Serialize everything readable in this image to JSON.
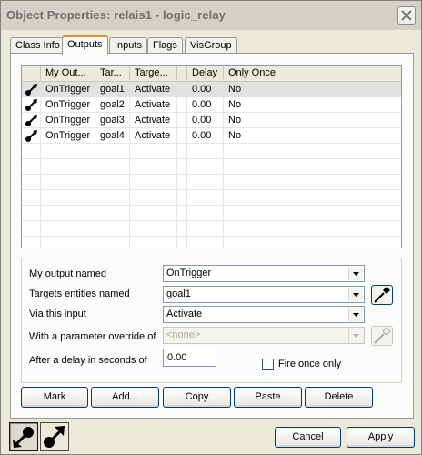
{
  "window": {
    "title": "Object Properties: relais1 - logic_relay",
    "close_glyph": "close-icon"
  },
  "tabs": [
    {
      "label": "Class Info",
      "active": false
    },
    {
      "label": "Outputs",
      "active": true
    },
    {
      "label": "Inputs",
      "active": false
    },
    {
      "label": "Flags",
      "active": false
    },
    {
      "label": "VisGroup",
      "active": false
    }
  ],
  "outputs_list": {
    "columns": [
      "",
      "My Out...",
      "Tar...",
      "Targe...",
      "",
      "Delay",
      "Only Once"
    ],
    "rows": [
      {
        "icon": "output-connection-icon",
        "output": "OnTrigger",
        "target": "goal1",
        "input": "Activate",
        "delay": "0.00",
        "only_once": "No",
        "selected": true
      },
      {
        "icon": "output-connection-icon",
        "output": "OnTrigger",
        "target": "goal2",
        "input": "Activate",
        "delay": "0.00",
        "only_once": "No",
        "selected": false
      },
      {
        "icon": "output-connection-icon",
        "output": "OnTrigger",
        "target": "goal3",
        "input": "Activate",
        "delay": "0.00",
        "only_once": "No",
        "selected": false
      },
      {
        "icon": "output-connection-icon",
        "output": "OnTrigger",
        "target": "goal4",
        "input": "Activate",
        "delay": "0.00",
        "only_once": "No",
        "selected": false
      }
    ]
  },
  "details": {
    "output_label": "My output named",
    "output_value": "OnTrigger",
    "target_label": "Targets entities named",
    "target_value": "goal1",
    "input_label": "Via this input",
    "input_value": "Activate",
    "param_label": "With a parameter override of",
    "param_value": "<none>",
    "delay_label": "After a delay in seconds of",
    "delay_value": "0.00",
    "fire_once_label": "Fire once only",
    "fire_once_checked": false
  },
  "buttons": {
    "mark": "Mark",
    "add": "Add...",
    "copy": "Copy",
    "paste": "Paste",
    "delete": "Delete",
    "cancel": "Cancel",
    "apply": "Apply"
  },
  "bottom_icons": {
    "incoming": "incoming-connections-icon",
    "outgoing": "outgoing-connections-icon"
  },
  "colors": {
    "active_tab_accent": "#e68b2c",
    "selected_row": "#e1e1e1"
  }
}
